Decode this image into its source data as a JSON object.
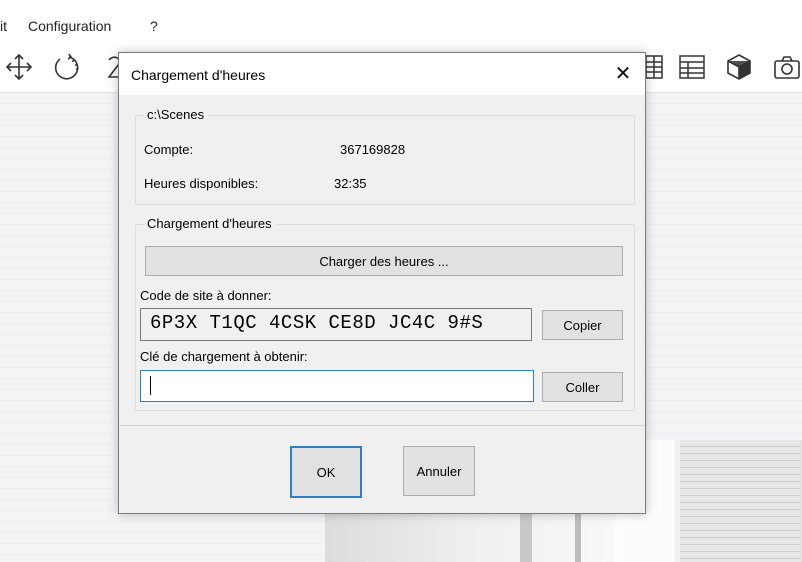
{
  "menu": {
    "items": [
      "it",
      "Configuration",
      "?"
    ]
  },
  "toolbar": {
    "icons": [
      "move-icon",
      "rotate-icon",
      "grid-icon",
      "table-icon",
      "cube-icon",
      "camera-icon"
    ]
  },
  "dialog": {
    "title": "Chargement d'heures",
    "close_glyph": "✕",
    "info_group": {
      "label": "c:\\Scenes",
      "account_label": "Compte:",
      "account_value": "367169828",
      "hours_label": "Heures disponibles:",
      "hours_value": "32:35"
    },
    "load_group": {
      "label": "Chargement d'heures",
      "load_button": "Charger des heures ...",
      "site_code_label": "Code de site à donner:",
      "site_code_value": "6P3X T1QC 4CSK CE8D JC4C 9#S",
      "copy_button": "Copier",
      "key_label": "Clé de chargement à obtenir:",
      "key_value": "",
      "paste_button": "Coller"
    },
    "ok_button": "OK",
    "cancel_button": "Annuler"
  },
  "colors": {
    "accent": "#2f7fc5",
    "dialog_bg": "#f0f0f0",
    "button_bg": "#e1e1e1"
  }
}
